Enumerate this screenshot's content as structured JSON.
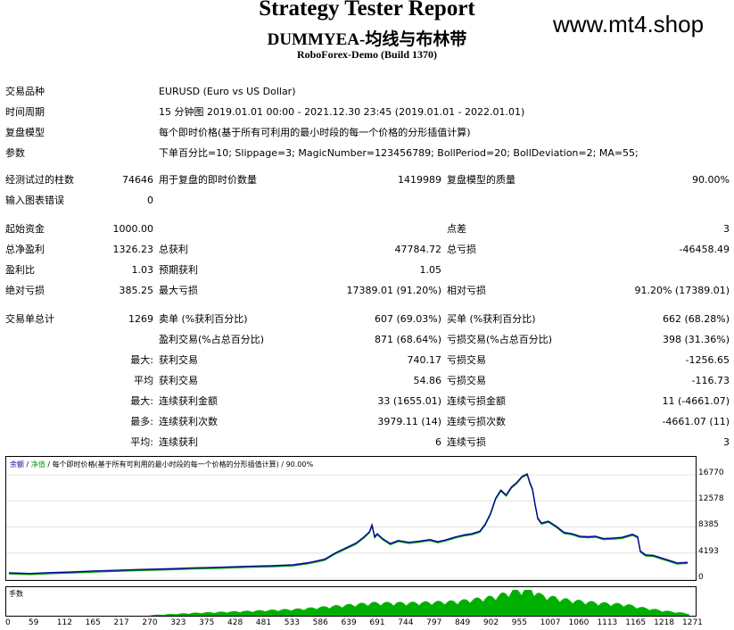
{
  "header": {
    "title": "Strategy Tester Report",
    "ea_name": "DUMMYEA-均线与布林带",
    "server": "RoboForex-Demo (Build 1370)",
    "watermark": "www.mt4.shop"
  },
  "info": {
    "symbol_label": "交易品种",
    "symbol_value": "EURUSD (Euro vs US Dollar)",
    "period_label": "时间周期",
    "period_value": "15 分钟图 2019.01.01 00:00 - 2021.12.30 23:45 (2019.01.01 - 2022.01.01)",
    "model_label": "复盘模型",
    "model_value": "每个即时价格(基于所有可利用的最小时段的每一个价格的分形插值计算)",
    "params_label": "参数",
    "params_value": "下单百分比=10; Slippage=3; MagicNumber=123456789; BollPeriod=20; BollDeviation=2; MA=55;"
  },
  "stats": {
    "bars_label": "经测试过的柱数",
    "bars_value": "74646",
    "ticks_label": "用于复盘的即时价数量",
    "ticks_value": "1419989",
    "quality_label": "复盘模型的质量",
    "quality_value": "90.00%",
    "errors_label": "输入图表错误",
    "errors_value": "0",
    "deposit_label": "起始资金",
    "deposit_value": "1000.00",
    "spread_label": "点差",
    "spread_value": "3",
    "net_label": "总净盈利",
    "net_value": "1326.23",
    "gross_profit_label": "总获利",
    "gross_profit_value": "47784.72",
    "gross_loss_label": "总亏损",
    "gross_loss_value": "-46458.49",
    "pf_label": "盈利比",
    "pf_value": "1.03",
    "payoff_label": "预期获利",
    "payoff_value": "1.05",
    "abs_dd_label": "绝对亏损",
    "abs_dd_value": "385.25",
    "max_dd_label": "最大亏损",
    "max_dd_value": "17389.01 (91.20%)",
    "rel_dd_label": "相对亏损",
    "rel_dd_value": "91.20% (17389.01)",
    "total_trades_label": "交易单总计",
    "total_trades_value": "1269",
    "short_label": "卖单 (%获利百分比)",
    "short_value": "607 (69.03%)",
    "long_label": "买单 (%获利百分比)",
    "long_value": "662 (68.28%)",
    "win_trades_label": "盈利交易(%占总百分比)",
    "win_trades_value": "871 (68.64%)",
    "loss_trades_label": "亏损交易(%占总百分比)",
    "loss_trades_value": "398 (31.36%)",
    "max_prefix": "最大:",
    "largest_win_label": "获利交易",
    "largest_win_value": "740.17",
    "largest_loss_label": "亏损交易",
    "largest_loss_value": "-1256.65",
    "avg_prefix": "平均",
    "avg_win_label": "获利交易",
    "avg_win_value": "54.86",
    "avg_loss_label": "亏损交易",
    "avg_loss_value": "-116.73",
    "max2_prefix": "最大:",
    "max_cons_win_amt_label": "连续获利金额",
    "max_cons_win_amt_value": "33 (1655.01)",
    "max_cons_loss_amt_label": "连续亏损金额",
    "max_cons_loss_amt_value": "11 (-4661.07)",
    "most_prefix": "最多:",
    "max_cons_win_cnt_label": "连续获利次数",
    "max_cons_win_cnt_value": "3979.11 (14)",
    "max_cons_loss_cnt_label": "连续亏损次数",
    "max_cons_loss_cnt_value": "-4661.07 (11)",
    "avg2_prefix": "平均:",
    "avg_cons_win_label": "连续获利",
    "avg_cons_win_value": "6",
    "avg_cons_loss_label": "连续亏损",
    "avg_cons_loss_value": "3"
  },
  "chart_data": {
    "type": "line",
    "legend": {
      "balance": "余额",
      "sep1": " / ",
      "equity": "净值",
      "rest": " / 每个即时价格(基于所有可利用的最小时段的每一个价格的分形插值计算) / 90.00%"
    },
    "volume_label": "手数",
    "ylim": [
      0,
      18200
    ],
    "y_ticks": [
      "16770",
      "12578",
      "8385",
      "4193",
      "0"
    ],
    "y_tick_values": [
      16770,
      12578,
      8385,
      4193,
      0
    ],
    "xlim": [
      0,
      1300
    ],
    "x_ticks": [
      "0",
      "59",
      "112",
      "165",
      "217",
      "270",
      "323",
      "375",
      "428",
      "481",
      "533",
      "586",
      "639",
      "691",
      "744",
      "797",
      "849",
      "902",
      "955",
      "1007",
      "1060",
      "1113",
      "1165",
      "1218",
      "1271"
    ],
    "balance_series": [
      [
        0,
        1000
      ],
      [
        40,
        900
      ],
      [
        80,
        1050
      ],
      [
        120,
        1150
      ],
      [
        160,
        1300
      ],
      [
        200,
        1400
      ],
      [
        250,
        1550
      ],
      [
        300,
        1650
      ],
      [
        350,
        1800
      ],
      [
        400,
        1900
      ],
      [
        450,
        2050
      ],
      [
        500,
        2150
      ],
      [
        540,
        2300
      ],
      [
        570,
        2650
      ],
      [
        600,
        3200
      ],
      [
        620,
        4200
      ],
      [
        640,
        5000
      ],
      [
        660,
        5800
      ],
      [
        675,
        6800
      ],
      [
        685,
        7600
      ],
      [
        690,
        8700
      ],
      [
        695,
        6800
      ],
      [
        700,
        7300
      ],
      [
        710,
        6500
      ],
      [
        725,
        5700
      ],
      [
        740,
        6200
      ],
      [
        760,
        5900
      ],
      [
        780,
        6100
      ],
      [
        800,
        6350
      ],
      [
        815,
        6000
      ],
      [
        830,
        6300
      ],
      [
        850,
        6800
      ],
      [
        865,
        7100
      ],
      [
        880,
        7300
      ],
      [
        895,
        7700
      ],
      [
        905,
        8800
      ],
      [
        915,
        10500
      ],
      [
        925,
        13000
      ],
      [
        935,
        14300
      ],
      [
        945,
        13500
      ],
      [
        955,
        14800
      ],
      [
        965,
        15500
      ],
      [
        975,
        16500
      ],
      [
        985,
        16900
      ],
      [
        990,
        15500
      ],
      [
        995,
        14500
      ],
      [
        1000,
        12000
      ],
      [
        1005,
        9800
      ],
      [
        1012,
        9000
      ],
      [
        1025,
        9300
      ],
      [
        1040,
        8500
      ],
      [
        1055,
        7500
      ],
      [
        1070,
        7300
      ],
      [
        1085,
        6900
      ],
      [
        1100,
        6800
      ],
      [
        1115,
        6900
      ],
      [
        1130,
        6500
      ],
      [
        1150,
        6600
      ],
      [
        1165,
        6700
      ],
      [
        1185,
        7200
      ],
      [
        1195,
        6800
      ],
      [
        1200,
        4500
      ],
      [
        1210,
        3900
      ],
      [
        1225,
        3800
      ],
      [
        1240,
        3400
      ],
      [
        1255,
        3000
      ],
      [
        1270,
        2600
      ],
      [
        1290,
        2700
      ]
    ],
    "volume_series": [
      [
        0,
        0
      ],
      [
        250,
        0
      ],
      [
        270,
        0.05
      ],
      [
        350,
        0.12
      ],
      [
        450,
        0.18
      ],
      [
        550,
        0.25
      ],
      [
        620,
        0.35
      ],
      [
        690,
        0.45
      ],
      [
        760,
        0.45
      ],
      [
        850,
        0.5
      ],
      [
        920,
        0.65
      ],
      [
        960,
        0.85
      ],
      [
        990,
        0.9
      ],
      [
        1010,
        0.7
      ],
      [
        1060,
        0.55
      ],
      [
        1120,
        0.45
      ],
      [
        1170,
        0.4
      ],
      [
        1200,
        0.3
      ],
      [
        1240,
        0.2
      ],
      [
        1290,
        0.1
      ]
    ]
  }
}
